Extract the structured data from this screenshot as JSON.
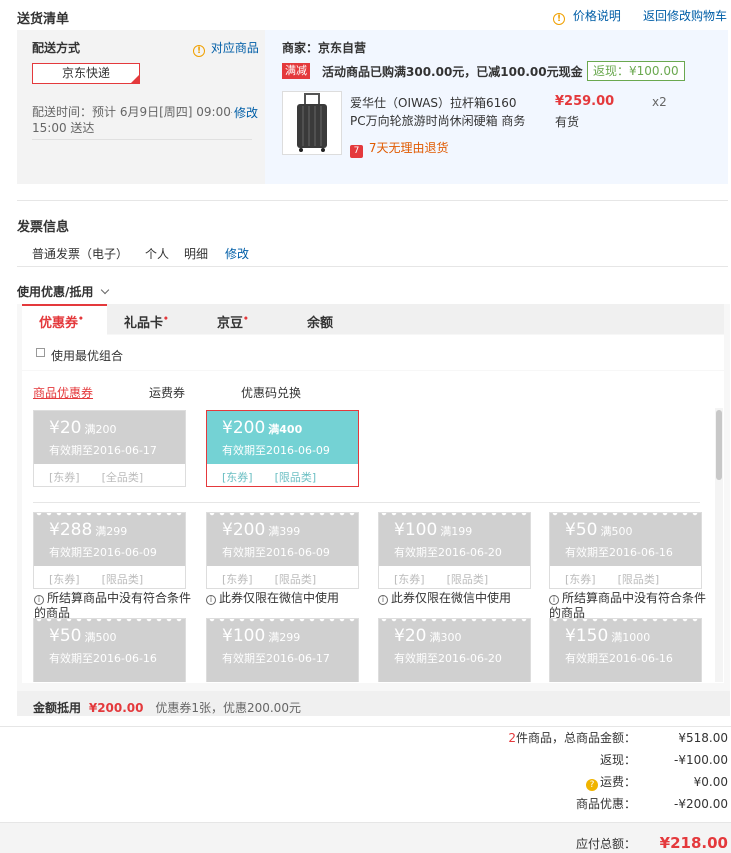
{
  "delivery": {
    "section_title": "送货清单",
    "price_info_link": "价格说明",
    "back_to_cart_link": "返回修改购物车",
    "shipping_method_label": "配送方式",
    "matched_items_link": "对应商品",
    "shipping_option": "京东快递",
    "delivery_time_label": "配送时间：",
    "delivery_time_value": "预计 6月9日[周四] 09:00-15:00 送达",
    "delivery_time_edit": "修改",
    "seller_label": "商家：",
    "seller_name": "京东自营",
    "promo_badge": "满减",
    "promo_text": "活动商品已购满300.00元，已减100.00元现金",
    "cashback_text": "返现：¥100.00",
    "product_name": "爱华仕（OIWAS）拉杆箱6160 PC万向轮旅游时尚休闲硬箱 商务",
    "product_price": "¥259.00",
    "product_qty": "x2",
    "product_stock": "有货",
    "return_badge": "7",
    "return_policy": "7天无理由退货"
  },
  "invoice": {
    "section_title": "发票信息",
    "type": "普通发票（电子）",
    "title": "个人",
    "content": "明细",
    "edit": "修改"
  },
  "discount": {
    "section_title": "使用优惠/抵用",
    "tabs": [
      "优惠券",
      "礼品卡",
      "京豆",
      "余额"
    ],
    "tab_marks": [
      "•",
      "•",
      "•",
      ""
    ],
    "best_combo_label": "使用最优组合",
    "subtabs": [
      "商品优惠券",
      "运费券",
      "优惠码兑换"
    ],
    "available": [
      {
        "amount": "¥20",
        "condition": "满200",
        "expiry": "有效期至2016-06-17",
        "tag1": "[东券]",
        "tag2": "[全品类]"
      },
      {
        "amount": "¥200",
        "condition": "满400",
        "expiry": "有效期至2016-06-09",
        "tag1": "[东券]",
        "tag2": "[限品类]"
      }
    ],
    "unavailable": [
      {
        "amount": "¥288",
        "condition": "满299",
        "expiry": "有效期至2016-06-09",
        "tag1": "[东券]",
        "tag2": "[限品类]",
        "note": "所结算商品中没有符合条件的商品"
      },
      {
        "amount": "¥200",
        "condition": "满399",
        "expiry": "有效期至2016-06-09",
        "tag1": "[东券]",
        "tag2": "[限品类]",
        "note": "此券仅限在微信中使用"
      },
      {
        "amount": "¥100",
        "condition": "满199",
        "expiry": "有效期至2016-06-20",
        "tag1": "[东券]",
        "tag2": "[限品类]",
        "note": "此券仅限在微信中使用"
      },
      {
        "amount": "¥50",
        "condition": "满500",
        "expiry": "有效期至2016-06-16",
        "tag1": "[东券]",
        "tag2": "[限品类]",
        "note": "所结算商品中没有符合条件的商品"
      },
      {
        "amount": "¥50",
        "condition": "满500",
        "expiry": "有效期至2016-06-16"
      },
      {
        "amount": "¥100",
        "condition": "满299",
        "expiry": "有效期至2016-06-17"
      },
      {
        "amount": "¥20",
        "condition": "满300",
        "expiry": "有效期至2016-06-20"
      },
      {
        "amount": "¥150",
        "condition": "满1000",
        "expiry": "有效期至2016-06-16"
      }
    ],
    "summary_label": "金额抵用",
    "summary_amount": "¥200.00",
    "summary_detail": "优惠券1张，优惠200.00元"
  },
  "totals": {
    "item_count": "2",
    "item_count_suffix": "件商品，总商品金额：",
    "item_total": "¥518.00",
    "cashback_label": "返现：",
    "cashback": "-¥100.00",
    "shipping_label": "运费：",
    "shipping": "¥0.00",
    "product_discount_label": "商品优惠：",
    "product_discount": "-¥200.00",
    "payable_label": "应付总额：",
    "payable": "¥218.00"
  },
  "colors": {
    "accent_red": "#e4393c",
    "link_blue": "#005ea7",
    "selected_coupon": "#74d2d4",
    "disabled_coupon": "#d0d0d0",
    "cashback_green": "#6aa84f"
  }
}
